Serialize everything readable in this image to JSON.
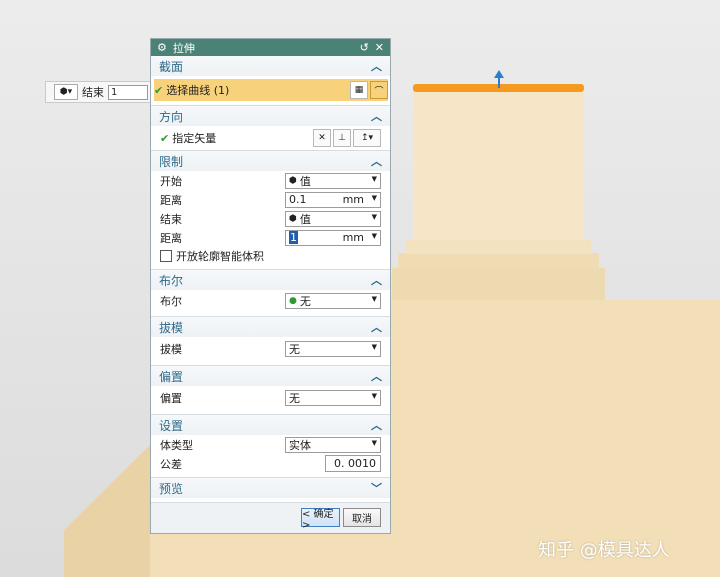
{
  "mini_toolbar": {
    "label": "结束",
    "value": "1"
  },
  "dialog": {
    "title": "拉伸",
    "section_section": {
      "header": "截面",
      "select_curve": "选择曲线 (1)"
    },
    "section_direction": {
      "header": "方向",
      "specify_vector": "指定矢量"
    },
    "section_limits": {
      "header": "限制",
      "start_label": "开始",
      "start_value": "值",
      "start_distance_label": "距离",
      "start_distance_value": "0.1",
      "start_distance_unit": "mm",
      "end_label": "结束",
      "end_value": "值",
      "end_distance_label": "距离",
      "end_distance_value": "1",
      "end_distance_unit": "mm",
      "open_profile_label": "开放轮廓智能体积"
    },
    "section_boolean": {
      "header": "布尔",
      "label": "布尔",
      "value": "无"
    },
    "section_draft": {
      "header": "拔模",
      "label": "拔模",
      "value": "无"
    },
    "section_offset": {
      "header": "偏置",
      "label": "偏置",
      "value": "无"
    },
    "section_settings": {
      "header": "设置",
      "body_type_label": "体类型",
      "body_type_value": "实体",
      "tolerance_label": "公差",
      "tolerance_value": "0. 0010"
    },
    "section_preview": {
      "header": "预览"
    },
    "ok_label": "< 确定 >",
    "cancel_label": "取消"
  },
  "watermark": "知乎 @模具达人",
  "colors": {
    "titlebar": "#4b8276",
    "selected": "#f7d27a",
    "highlight_edge": "#f59a1e",
    "model": "#f2dfb8"
  }
}
